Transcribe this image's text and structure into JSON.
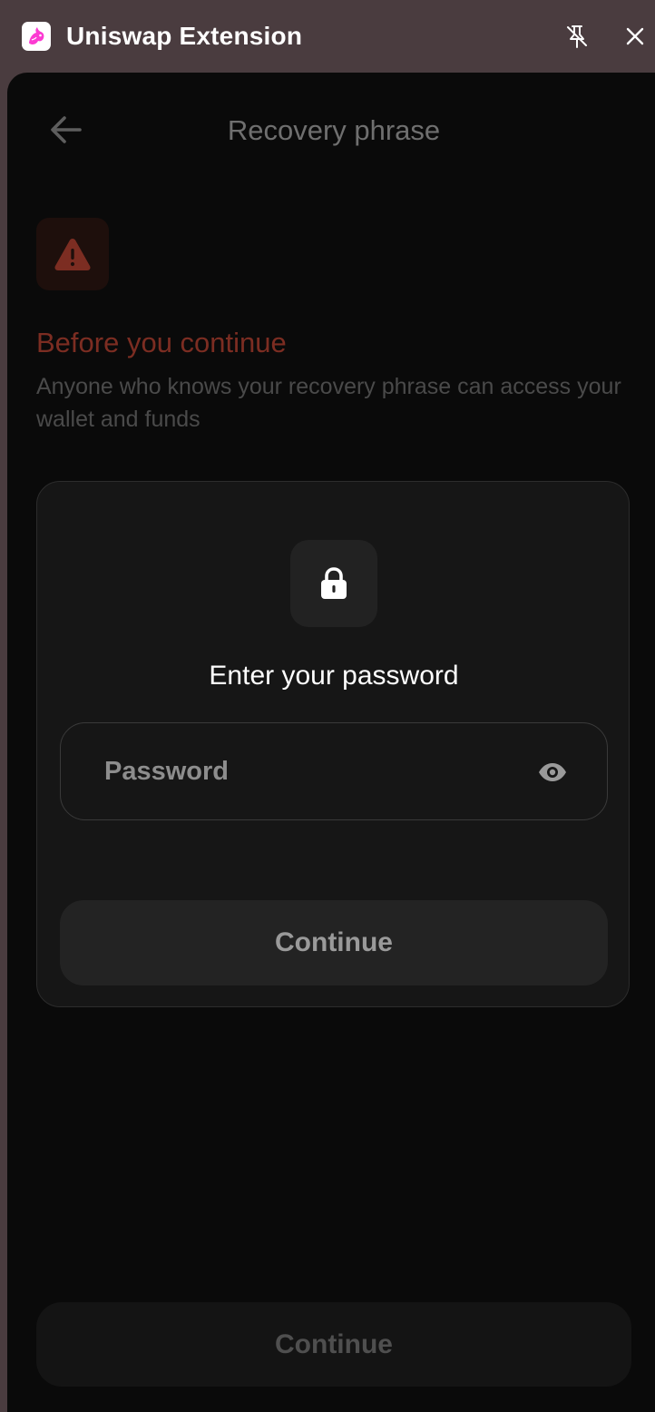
{
  "titlebar": {
    "app_title": "Uniswap Extension",
    "logo_icon": "uniswap-unicorn-icon",
    "unpin_icon": "unpin-icon",
    "close_icon": "close-icon"
  },
  "header": {
    "back_icon": "arrow-left-icon",
    "title": "Recovery phrase"
  },
  "warning": {
    "icon": "warning-triangle-icon",
    "title": "Before you continue",
    "text": "Anyone who knows your recovery phrase can access your wallet and funds"
  },
  "password_card": {
    "lock_icon": "lock-icon",
    "title": "Enter your password",
    "password_placeholder": "Password",
    "password_value": "",
    "visibility_icon": "eye-icon",
    "continue_label": "Continue"
  },
  "footer": {
    "continue_label": "Continue"
  },
  "colors": {
    "background": "#0a0a0a",
    "titlebar": "#4a3c3f",
    "warning_accent": "#7c2d22",
    "brand": "#fc72ff"
  }
}
